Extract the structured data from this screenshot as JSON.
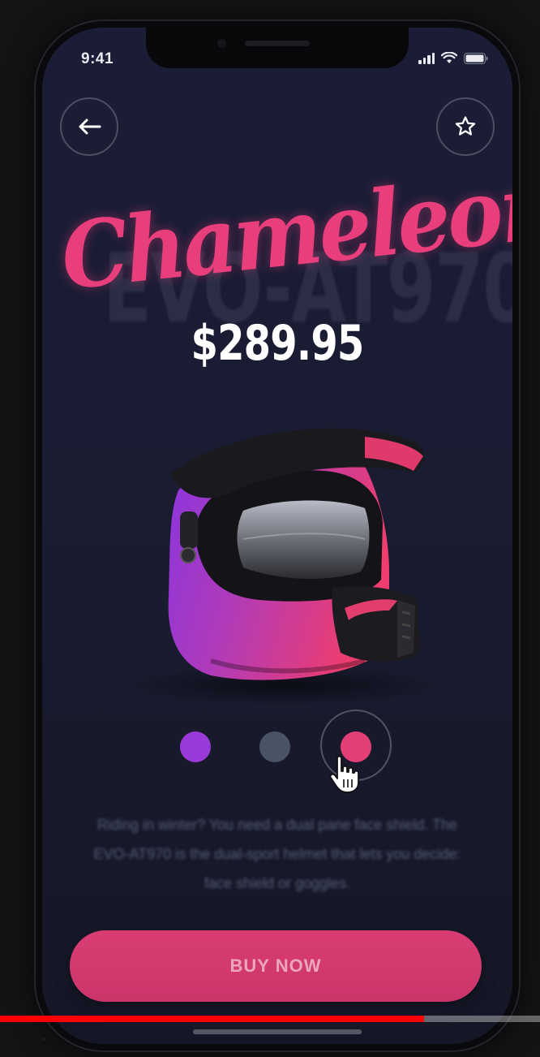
{
  "status_bar": {
    "time": "9:41"
  },
  "product": {
    "name": "Chameleon",
    "model": "EVO-AT970",
    "price": "$289.95",
    "description": "Riding in winter? You need a dual pane face shield. The EVO-AT970 is the dual-sport helmet that lets you decide: face shield or goggles."
  },
  "color_options": [
    {
      "name": "purple",
      "color": "#9a3ad8"
    },
    {
      "name": "gray",
      "color": "#4a5266"
    },
    {
      "name": "pink",
      "color": "#e23f77",
      "selected": true
    }
  ],
  "buy_button": {
    "label": "BUY NOW"
  },
  "colors": {
    "accent": "#e83e7c",
    "background": "#1b1d36",
    "button": "#d93d73"
  },
  "icons": {
    "back": "arrow-left-icon",
    "favorite": "star-outline-icon",
    "cursor": "hand-pointer-icon"
  },
  "video": {
    "progress": 0.785
  }
}
